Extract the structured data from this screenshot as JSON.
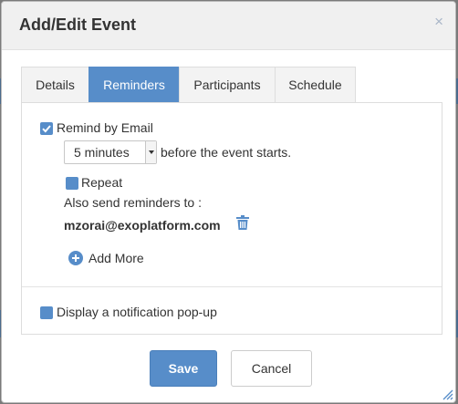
{
  "modal": {
    "title": "Add/Edit Event",
    "close_label": "×"
  },
  "tabs": [
    {
      "label": "Details",
      "active": false
    },
    {
      "label": "Reminders",
      "active": true
    },
    {
      "label": "Participants",
      "active": false
    },
    {
      "label": "Schedule",
      "active": false
    }
  ],
  "reminders": {
    "email_label": "Remind by Email",
    "email_checked": true,
    "interval_value": "5 minutes",
    "before_text": "before the event starts.",
    "repeat_label": "Repeat",
    "repeat_checked": false,
    "also_send_label": "Also send reminders to :",
    "recipient_email": "mzorai@exoplatform.com",
    "add_more_label": "Add More",
    "popup_label": "Display a notification pop-up",
    "popup_checked": false
  },
  "footer": {
    "save_label": "Save",
    "cancel_label": "Cancel"
  },
  "colors": {
    "accent": "#578dc9",
    "header_bg": "#f0f0f0"
  },
  "icons": {
    "close": "close-icon",
    "check": "check-icon",
    "trash": "trash-icon",
    "plus": "plus-circle-icon",
    "resize": "resize-handle-icon"
  }
}
